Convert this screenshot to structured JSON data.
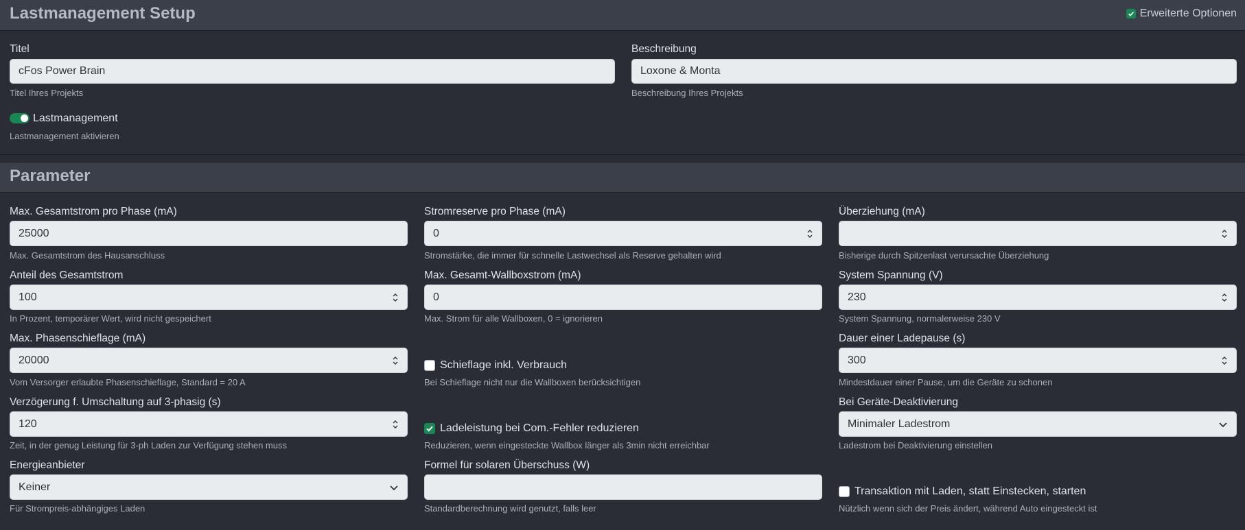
{
  "setup": {
    "title": "Lastmanagement Setup",
    "advanced_label": "Erweiterte Optionen",
    "advanced_checked": true,
    "titel_label": "Titel",
    "titel_value": "cFos Power Brain",
    "titel_help": "Titel Ihres Projekts",
    "beschreibung_label": "Beschreibung",
    "beschreibung_value": "Loxone & Monta",
    "beschreibung_help": "Beschreibung Ihres Projekts",
    "lastmanagement_label": "Lastmanagement",
    "lastmanagement_help": "Lastmanagement aktivieren",
    "lastmanagement_on": true
  },
  "parameter": {
    "title": "Parameter",
    "max_gesamtstrom": {
      "label": "Max. Gesamtstrom pro Phase (mA)",
      "value": "25000",
      "help": "Max. Gesamtstrom des Hausanschluss"
    },
    "stromreserve": {
      "label": "Stromreserve pro Phase (mA)",
      "value": "0",
      "help": "Stromstärke, die immer für schnelle Lastwechsel als Reserve gehalten wird"
    },
    "ueberziehung": {
      "label": "Überziehung (mA)",
      "value": "",
      "help": "Bisherige durch Spitzenlast verursachte Überziehung"
    },
    "anteil": {
      "label": "Anteil des Gesamtstrom",
      "value": "100",
      "help": "In Prozent, temporärer Wert, wird nicht gespeichert"
    },
    "max_wallboxstrom": {
      "label": "Max. Gesamt-Wallboxstrom (mA)",
      "value": "0",
      "help": "Max. Strom für alle Wallboxen, 0 = ignorieren"
    },
    "spannung": {
      "label": "System Spannung (V)",
      "value": "230",
      "help": "System Spannung, normalerweise 230 V"
    },
    "phasenschieflage": {
      "label": "Max. Phasenschieflage (mA)",
      "value": "20000",
      "help": "Vom Versorger erlaubte Phasenschieflage, Standard = 20 A"
    },
    "schieflage_check": {
      "label": "Schieflage inkl. Verbrauch",
      "checked": false,
      "help": "Bei Schieflage nicht nur die Wallboxen berücksichtigen"
    },
    "ladepause": {
      "label": "Dauer einer Ladepause (s)",
      "value": "300",
      "help": "Mindestdauer einer Pause, um die Geräte zu schonen"
    },
    "verzoegerung": {
      "label": "Verzögerung f. Umschaltung auf 3-phasig (s)",
      "value": "120",
      "help": "Zeit, in der genug Leistung für 3-ph Laden zur Verfügung stehen muss"
    },
    "comfehler_check": {
      "label": "Ladeleistung bei Com.-Fehler reduzieren",
      "checked": true,
      "help": "Reduzieren, wenn eingesteckte Wallbox länger als 3min nicht erreichbar"
    },
    "deaktivierung": {
      "label": "Bei Geräte-Deaktivierung",
      "value": "Minimaler Ladestrom",
      "help": "Ladestrom bei Deaktivierung einstellen"
    },
    "energieanbieter": {
      "label": "Energieanbieter",
      "value": "Keiner",
      "help": "Für Strompreis-abhängiges Laden"
    },
    "formel": {
      "label": "Formel für solaren Überschuss (W)",
      "value": "",
      "help": "Standardberechnung wird genutzt, falls leer"
    },
    "transaktion_check": {
      "label": "Transaktion mit Laden, statt Einstecken, starten",
      "checked": false,
      "help": "Nützlich wenn sich der Preis ändert, während Auto eingesteckt ist"
    }
  },
  "colors": {
    "accent": "#198754",
    "header_bg": "#3a3f4a",
    "page_bg": "#2a2c36",
    "input_bg": "#e9ecef"
  },
  "icons": {
    "spinner": "spinner-arrows-icon",
    "dropdown": "chevron-down-icon",
    "check": "checkmark-icon"
  }
}
